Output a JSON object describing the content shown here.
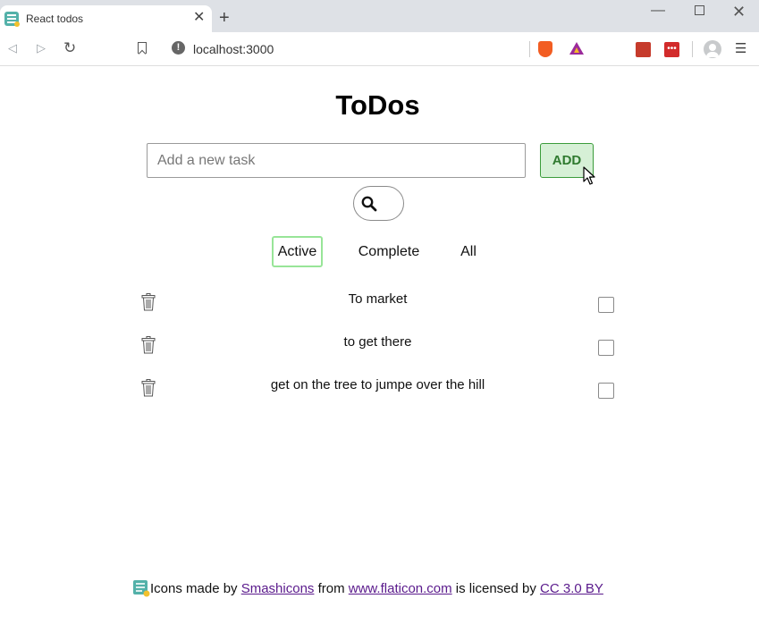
{
  "browser": {
    "tab_title": "React todos",
    "tab_close": "✕",
    "new_tab": "+",
    "url": "localhost:3000",
    "win_min": "—",
    "win_close": "✕",
    "menu": "☰"
  },
  "app": {
    "title": "ToDos",
    "input_placeholder": "Add a new task",
    "add_label": "ADD",
    "filters": [
      "Active",
      "Complete",
      "All"
    ],
    "todos": [
      {
        "text": "To market",
        "done": false
      },
      {
        "text": "to get there",
        "done": false
      },
      {
        "text": "get on the tree to jumpe over the hill",
        "done": false
      }
    ]
  },
  "footer": {
    "prefix": "Icons made by ",
    "author": "Smashicons",
    "middle": " from ",
    "site": "www.flaticon.com",
    "license_text": " is licensed by ",
    "license": "CC 3.0 BY"
  },
  "colors": {
    "add_bg": "#d6f0d6",
    "add_border": "#3b9c3b",
    "active_filter_border": "#98e598",
    "link": "#5a1a8c"
  }
}
